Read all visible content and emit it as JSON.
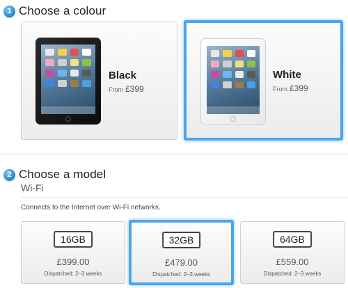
{
  "step1": {
    "number": "1",
    "title": "Choose a colour"
  },
  "colours": [
    {
      "name": "Black",
      "from": "From",
      "price": "£399"
    },
    {
      "name": "White",
      "from": "From",
      "price": "£399"
    }
  ],
  "selected_colour": "White",
  "step2": {
    "number": "2",
    "title": "Choose a model"
  },
  "model_type": "Wi-Fi",
  "model_description": "Connects to the Internet over Wi-Fi networks.",
  "models": [
    {
      "capacity": "16GB",
      "price": "£399.00",
      "dispatch": "Dispatched: 2–3 weeks"
    },
    {
      "capacity": "32GB",
      "price": "£479.00",
      "dispatch": "Dispatched: 2–3 weeks"
    },
    {
      "capacity": "64GB",
      "price": "£559.00",
      "dispatch": "Dispatched: 2–3 weeks"
    }
  ],
  "selected_model": "32GB",
  "colors": {
    "accent": "#4aa6ea",
    "step_badge": "#2f8fd6"
  }
}
